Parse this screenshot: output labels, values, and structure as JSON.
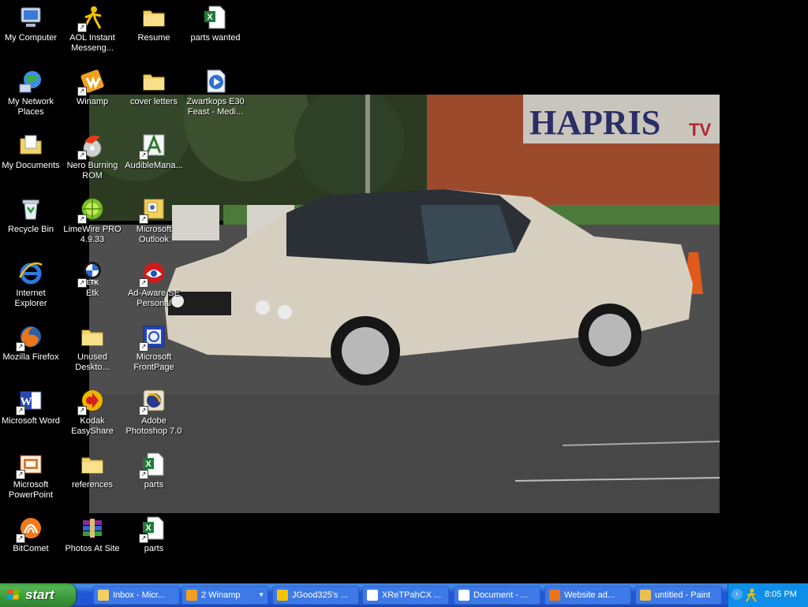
{
  "desktop": {
    "icons": [
      {
        "label": "My Computer",
        "icon": "my-computer-icon",
        "shortcut": false
      },
      {
        "label": "AOL Instant Messeng...",
        "icon": "aim-icon",
        "shortcut": true
      },
      {
        "label": "Resume",
        "icon": "folder-icon",
        "shortcut": false
      },
      {
        "label": "parts wanted",
        "icon": "excel-file-icon",
        "shortcut": false
      },
      {
        "label": "My Network Places",
        "icon": "network-places-icon",
        "shortcut": false
      },
      {
        "label": "Winamp",
        "icon": "winamp-icon",
        "shortcut": true
      },
      {
        "label": "cover letters",
        "icon": "folder-icon",
        "shortcut": false
      },
      {
        "label": "Zwartkops E30 Feast - Medi...",
        "icon": "media-file-icon",
        "shortcut": false
      },
      {
        "label": "My Documents",
        "icon": "my-documents-icon",
        "shortcut": false
      },
      {
        "label": "Nero Burning ROM",
        "icon": "nero-icon",
        "shortcut": true
      },
      {
        "label": "AudibleMana...",
        "icon": "audible-icon",
        "shortcut": true
      },
      {
        "label": "Recycle Bin",
        "icon": "recycle-bin-icon",
        "shortcut": false
      },
      {
        "label": "LimeWire PRO 4.9.33",
        "icon": "limewire-icon",
        "shortcut": true
      },
      {
        "label": "Microsoft Outlook",
        "icon": "outlook-icon",
        "shortcut": true
      },
      {
        "label": "Internet Explorer",
        "icon": "internet-explorer-icon",
        "shortcut": false
      },
      {
        "label": "Etk",
        "icon": "bmw-etk-icon",
        "shortcut": true
      },
      {
        "label": "Ad-Aware SE Personal",
        "icon": "ad-aware-icon",
        "shortcut": true
      },
      {
        "label": "Mozilla Firefox",
        "icon": "firefox-icon",
        "shortcut": true
      },
      {
        "label": "Unused Deskto...",
        "icon": "folder-icon",
        "shortcut": false
      },
      {
        "label": "Microsoft FrontPage",
        "icon": "frontpage-icon",
        "shortcut": true
      },
      {
        "label": "Microsoft Word",
        "icon": "word-icon",
        "shortcut": true
      },
      {
        "label": "Kodak EasyShare",
        "icon": "kodak-icon",
        "shortcut": true
      },
      {
        "label": "Adobe Photoshop 7.0",
        "icon": "photoshop-icon",
        "shortcut": true
      },
      {
        "label": "Microsoft PowerPoint",
        "icon": "powerpoint-icon",
        "shortcut": true
      },
      {
        "label": "references",
        "icon": "folder-icon",
        "shortcut": false
      },
      {
        "label": "parts",
        "icon": "excel-file-icon",
        "shortcut": true
      },
      {
        "label": "BitComet",
        "icon": "bitcomet-icon",
        "shortcut": true
      },
      {
        "label": "Photos At Site",
        "icon": "winrar-icon",
        "shortcut": false
      },
      {
        "label": "parts",
        "icon": "excel-file-icon",
        "shortcut": true
      }
    ]
  },
  "wallpaper": {
    "sign_text": "HAPRIS",
    "sign_suffix": "TV"
  },
  "taskbar": {
    "start_label": "start",
    "tasks": [
      {
        "label": "Inbox - Micr...",
        "icon": "outlook-icon",
        "active": false
      },
      {
        "label": "2 Winamp",
        "icon": "winamp-icon",
        "active": false,
        "grouped": true
      },
      {
        "label": "JGood325's ...",
        "icon": "aim-icon",
        "active": false
      },
      {
        "label": "XReTPahCX ...",
        "icon": "chat-icon",
        "active": false
      },
      {
        "label": "Document - ...",
        "icon": "document-icon",
        "active": false
      },
      {
        "label": "Website ad...",
        "icon": "firefox-icon",
        "active": false
      },
      {
        "label": "untitled - Paint",
        "icon": "paint-icon",
        "active": false
      }
    ],
    "tray": {
      "clock": "8:05 PM",
      "icons": [
        "show-hidden-icons-icon",
        "aim-tray-icon"
      ]
    }
  },
  "colors": {
    "taskbar_blue": "#2157d7",
    "start_green": "#3a9b3a",
    "tray_blue": "#0e8ee8",
    "car_body": "#d6cfbf"
  }
}
